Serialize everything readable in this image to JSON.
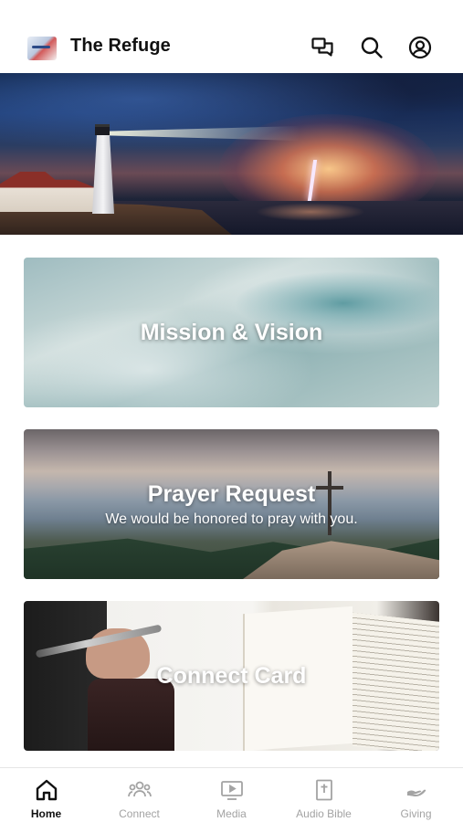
{
  "header": {
    "title": "The Refuge",
    "logo_icon": "church-logo-icon",
    "actions": [
      {
        "name": "chat-icon"
      },
      {
        "name": "search-icon"
      },
      {
        "name": "profile-icon"
      }
    ]
  },
  "hero": {
    "image": "lighthouse-storm-banner"
  },
  "cards": [
    {
      "title": "Mission & Vision",
      "subtitle": ""
    },
    {
      "title": "Prayer Request",
      "subtitle": "We would be honored to pray with you."
    },
    {
      "title": "Connect Card",
      "subtitle": ""
    }
  ],
  "tabbar": {
    "tabs": [
      {
        "label": "Home",
        "icon": "home-icon",
        "active": true
      },
      {
        "label": "Connect",
        "icon": "people-icon",
        "active": false
      },
      {
        "label": "Media",
        "icon": "tv-play-icon",
        "active": false
      },
      {
        "label": "Audio Bible",
        "icon": "bible-icon",
        "active": false
      },
      {
        "label": "Giving",
        "icon": "giving-hand-icon",
        "active": false
      }
    ]
  },
  "colors": {
    "text": "#111111",
    "inactive_tab": "#a3a3a3",
    "background": "#ffffff"
  }
}
